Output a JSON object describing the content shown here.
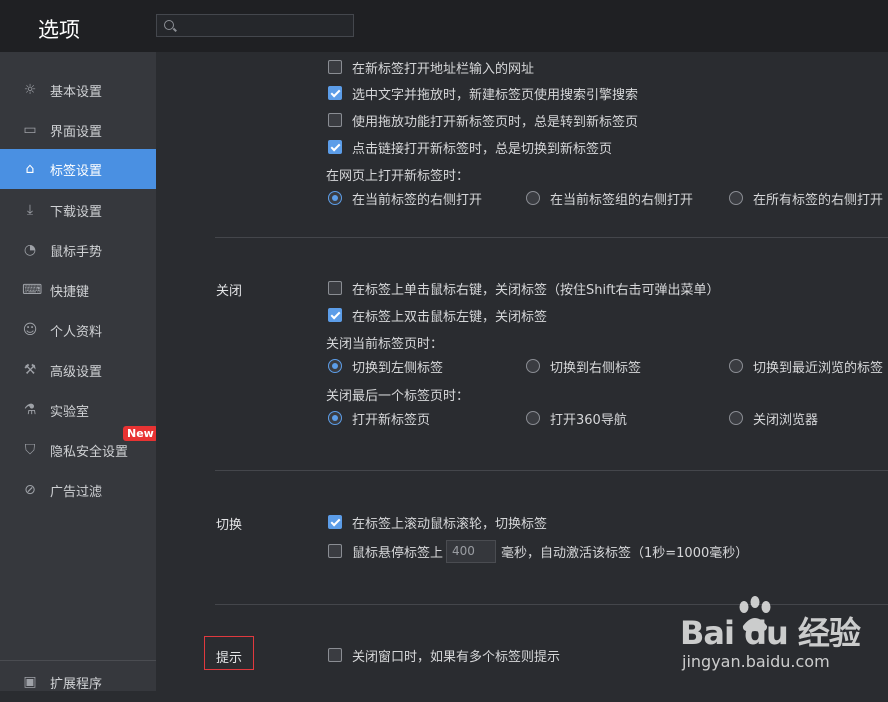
{
  "header": {
    "title": "选项",
    "search_placeholder": ""
  },
  "sidebar": {
    "items": [
      {
        "label": "基本设置",
        "icon": "gear-icon"
      },
      {
        "label": "界面设置",
        "icon": "window-icon"
      },
      {
        "label": "标签设置",
        "icon": "tab-icon",
        "active": true
      },
      {
        "label": "下载设置",
        "icon": "download-icon"
      },
      {
        "label": "鼠标手势",
        "icon": "mouse-icon"
      },
      {
        "label": "快捷键",
        "icon": "keyboard-icon"
      },
      {
        "label": "个人资料",
        "icon": "user-icon"
      },
      {
        "label": "高级设置",
        "icon": "wrench-icon"
      },
      {
        "label": "实验室",
        "icon": "flask-icon"
      },
      {
        "label": "隐私安全设置",
        "icon": "shield-icon",
        "badge": "New"
      },
      {
        "label": "广告过滤",
        "icon": "block-icon"
      }
    ],
    "footer_label": "扩展程序"
  },
  "open_section": {
    "options": [
      {
        "label": "在新标签打开地址栏输入的网址",
        "checked": false
      },
      {
        "label": "选中文字并拖放时，新建标签页使用搜索引擎搜索",
        "checked": true
      },
      {
        "label": "使用拖放功能打开新标签页时，总是转到新标签页",
        "checked": false
      },
      {
        "label": "点击链接打开新标签时，总是切换到新标签页",
        "checked": true
      }
    ],
    "position_label": "在网页上打开新标签时：",
    "position_radios": [
      {
        "label": "在当前标签的右侧打开",
        "checked": true
      },
      {
        "label": "在当前标签组的右侧打开",
        "checked": false
      },
      {
        "label": "在所有标签的右侧打开",
        "checked": false
      }
    ]
  },
  "close_section": {
    "title": "关闭",
    "options": [
      {
        "label": "在标签上单击鼠标右键，关闭标签（按住Shift右击可弹出菜单）",
        "checked": false
      },
      {
        "label": "在标签上双击鼠标左键，关闭标签",
        "checked": true
      }
    ],
    "current_label": "关闭当前标签页时：",
    "current_radios": [
      {
        "label": "切换到左侧标签",
        "checked": true
      },
      {
        "label": "切换到右侧标签",
        "checked": false
      },
      {
        "label": "切换到最近浏览的标签",
        "checked": false
      }
    ],
    "last_label": "关闭最后一个标签页时：",
    "last_radios": [
      {
        "label": "打开新标签页",
        "checked": true
      },
      {
        "label": "打开360导航",
        "checked": false
      },
      {
        "label": "关闭浏览器",
        "checked": false
      }
    ]
  },
  "switch_section": {
    "title": "切换",
    "wheel": {
      "label": "在标签上滚动鼠标滚轮，切换标签",
      "checked": true
    },
    "hover": {
      "label": "鼠标悬停标签上",
      "checked": false,
      "value": "400",
      "after": "毫秒，自动激活该标签（1秒=1000毫秒）"
    }
  },
  "hint_section": {
    "title": "提示",
    "option": {
      "label": "关闭窗口时，如果有多个标签则提示",
      "checked": false
    }
  },
  "watermark": {
    "logo": "Bai du 经验",
    "url": "jingyan.baidu.com"
  }
}
